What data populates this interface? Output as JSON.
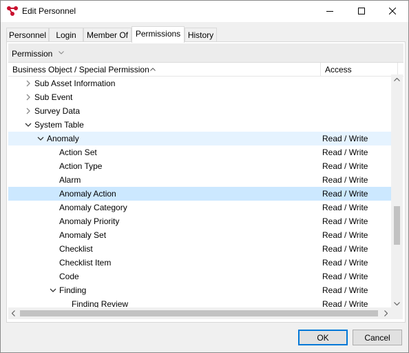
{
  "window": {
    "title": "Edit Personnel"
  },
  "tabs": [
    {
      "label": "Personnel"
    },
    {
      "label": "Login"
    },
    {
      "label": "Member Of"
    },
    {
      "label": "Permissions"
    },
    {
      "label": "History"
    }
  ],
  "active_tab": "Permissions",
  "group_bar": {
    "label": "Permission"
  },
  "grid": {
    "columns": {
      "object": "Business Object / Special Permission",
      "access": "Access"
    },
    "sort": "ascending",
    "rows": [
      {
        "name": "Sub Asset Information",
        "access": "",
        "level": 1,
        "expander": "collapsed"
      },
      {
        "name": "Sub Event",
        "access": "",
        "level": 1,
        "expander": "collapsed"
      },
      {
        "name": "Survey Data",
        "access": "",
        "level": 1,
        "expander": "collapsed"
      },
      {
        "name": "System Table",
        "access": "",
        "level": 1,
        "expander": "expanded"
      },
      {
        "name": "Anomaly",
        "access": "Read / Write",
        "level": 2,
        "expander": "expanded",
        "state": "hover"
      },
      {
        "name": "Action Set",
        "access": "Read / Write",
        "level": 3
      },
      {
        "name": "Action Type",
        "access": "Read / Write",
        "level": 3
      },
      {
        "name": "Alarm",
        "access": "Read / Write",
        "level": 3
      },
      {
        "name": "Anomaly Action",
        "access": "Read / Write",
        "level": 3,
        "state": "selected"
      },
      {
        "name": "Anomaly Category",
        "access": "Read / Write",
        "level": 3
      },
      {
        "name": "Anomaly Priority",
        "access": "Read / Write",
        "level": 3
      },
      {
        "name": "Anomaly Set",
        "access": "Read / Write",
        "level": 3
      },
      {
        "name": "Checklist",
        "access": "Read / Write",
        "level": 3
      },
      {
        "name": "Checklist Item",
        "access": "Read / Write",
        "level": 3
      },
      {
        "name": "Code",
        "access": "Read / Write",
        "level": 3
      },
      {
        "name": "Finding",
        "access": "Read / Write",
        "level": 3,
        "expander": "expanded"
      },
      {
        "name": "Finding Review",
        "access": "Read / Write",
        "level": 4
      }
    ]
  },
  "buttons": {
    "ok": "OK",
    "cancel": "Cancel"
  },
  "colors": {
    "selected_row": "#cce8ff",
    "hover_row": "#e5f3ff",
    "accent": "#0078d7",
    "app_icon": "#c8102e"
  }
}
